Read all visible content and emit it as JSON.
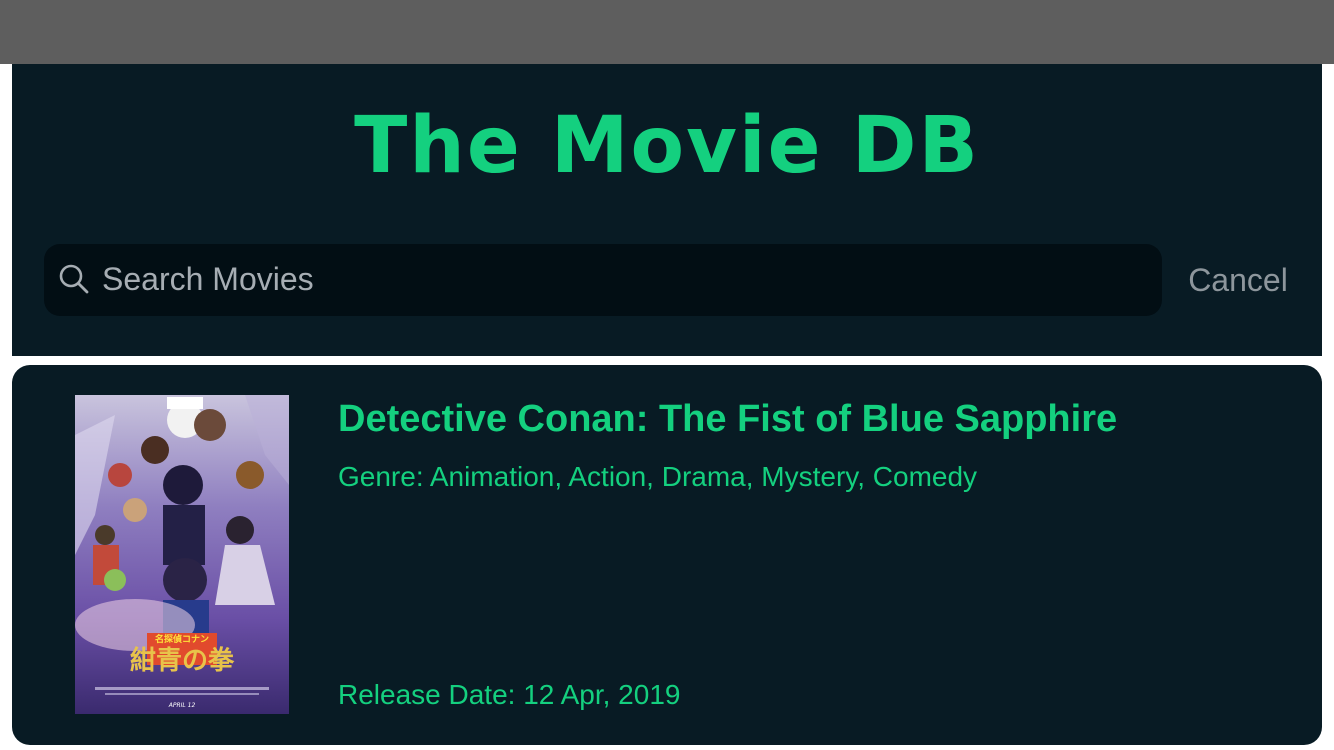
{
  "app": {
    "title": "The Movie DB"
  },
  "search": {
    "placeholder": "Search Movies",
    "value": "",
    "icon": "search-icon",
    "cancel_label": "Cancel"
  },
  "results": [
    {
      "title": "Detective Conan: The Fist of Blue Sapphire",
      "genre_text": "Genre: Animation, Action, Drama, Mystery, Comedy",
      "release_text": "Release Date: 12 Apr, 2019",
      "poster": {
        "logo_text": "名探偵コナン",
        "title_text": "紺青の拳",
        "date_text": "APRIL 12"
      }
    }
  ],
  "colors": {
    "accent": "#14d07f",
    "panel_background": "#081b24",
    "search_background": "#020e14",
    "status_bar": "#5e5e5e",
    "muted_text": "#8d969c"
  }
}
